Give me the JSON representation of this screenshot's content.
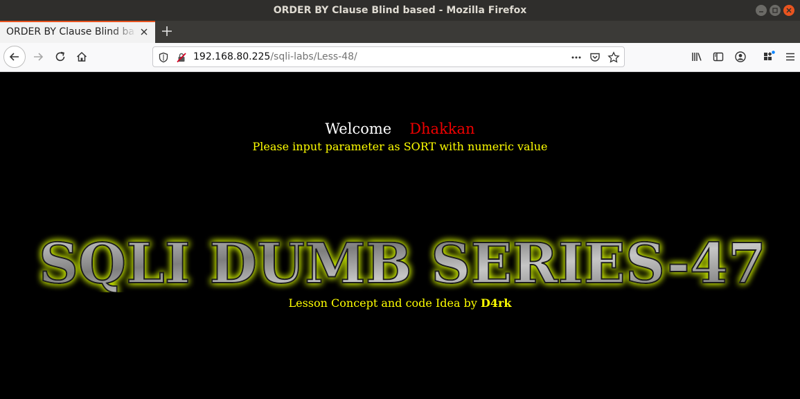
{
  "window": {
    "title": "ORDER BY Clause Blind based - Mozilla Firefox"
  },
  "tabs": [
    {
      "label": "ORDER BY Clause Blind based"
    }
  ],
  "address_bar": {
    "host": "192.168.80.225",
    "path": "/sqli-labs/Less-48/"
  },
  "page": {
    "welcome": "Welcome",
    "name": "Dhakkan",
    "instruction": "Please input parameter as SORT with numeric value",
    "banner": "SQLI DUMB SERIES-47",
    "lesson_prefix": "Lesson Concept and code Idea by ",
    "author": "D4rk"
  },
  "icons": [
    "close-icon",
    "minimize-icon",
    "maximize-icon",
    "tab-close-icon",
    "new-tab-icon",
    "back-icon",
    "forward-icon",
    "reload-icon",
    "home-icon",
    "shield-icon",
    "insecure-lock-icon",
    "more-actions-icon",
    "pocket-icon",
    "bookmark-star-icon",
    "library-icon",
    "sidebar-icon",
    "account-icon",
    "extensions-icon",
    "menu-icon"
  ],
  "colors": {
    "accent": "#e95420",
    "welcome_name": "#ee0000",
    "text_yellow": "#ffff00",
    "banner_glow": "#bcd600"
  }
}
